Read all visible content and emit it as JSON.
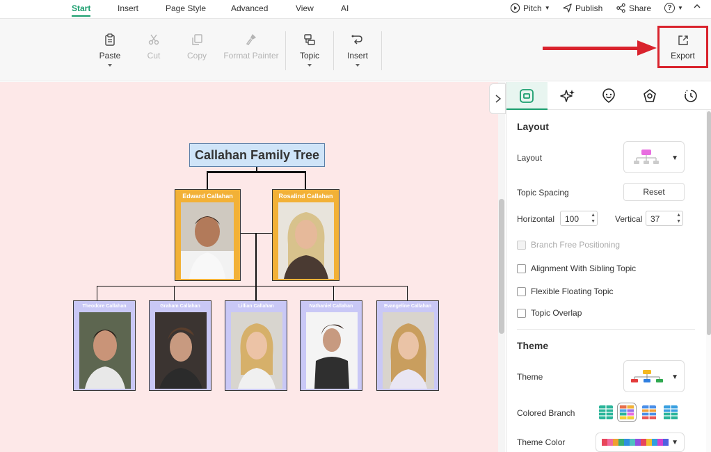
{
  "menu": {
    "tabs": [
      "Start",
      "Insert",
      "Page Style",
      "Advanced",
      "View",
      "AI"
    ],
    "active_tab": "Start",
    "pitch": "Pitch",
    "publish": "Publish",
    "share": "Share",
    "help": "?"
  },
  "toolbar": {
    "paste": "Paste",
    "cut": "Cut",
    "copy": "Copy",
    "format_painter": "Format Painter",
    "topic": "Topic",
    "insert": "Insert",
    "export": "Export"
  },
  "diagram": {
    "root": "Callahan Family Tree",
    "parents": [
      "Edward Callahan",
      "Rosalind Callahan"
    ],
    "children": [
      "Theodore Callahan",
      "Graham Callahan",
      "Lillian Callahan",
      "Nathaniel Callahan",
      "Evangeline Callahan"
    ],
    "colors": {
      "root_fill": "#cfe4f8",
      "parent_fill": "#f2b137",
      "child_fill": "#c9c8f6",
      "canvas": "#fde8e8"
    }
  },
  "panel": {
    "active_tab": "layout-icon",
    "tab_icons": [
      "layout-icon",
      "sparkle-icon",
      "emoji-icon",
      "badge-icon",
      "clock-icon"
    ],
    "layout_section": "Layout",
    "layout_label": "Layout",
    "topic_spacing": "Topic Spacing",
    "reset": "Reset",
    "horizontal_label": "Horizontal",
    "horizontal_value": "100",
    "vertical_label": "Vertical",
    "vertical_value": "37",
    "branch_free": "Branch Free Positioning",
    "alignment": "Alignment With Sibling Topic",
    "flexible": "Flexible Floating Topic",
    "overlap": "Topic Overlap",
    "theme_section": "Theme",
    "theme_label": "Theme",
    "colored_branch": "Colored Branch",
    "theme_color": "Theme Color"
  }
}
